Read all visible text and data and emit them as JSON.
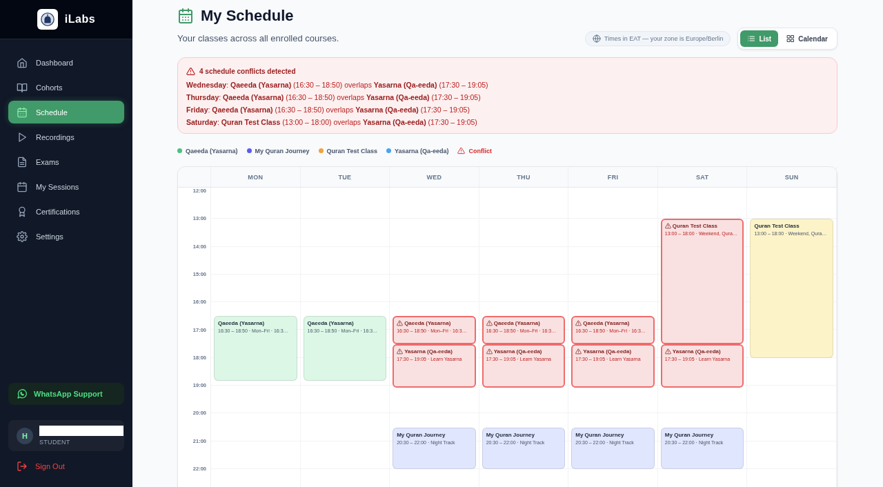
{
  "sidebar": {
    "brand": "iLabs",
    "nav": [
      {
        "label": "Dashboard",
        "selected": false
      },
      {
        "label": "Cohorts",
        "selected": false
      },
      {
        "label": "Schedule",
        "selected": true
      },
      {
        "label": "Recordings",
        "selected": false
      },
      {
        "label": "Exams",
        "selected": false
      },
      {
        "label": "My Sessions",
        "selected": false
      },
      {
        "label": "Certifications",
        "selected": false
      },
      {
        "label": "Settings",
        "selected": false
      }
    ],
    "support": "WhatsApp Support",
    "user": {
      "initial": "H",
      "role": "STUDENT"
    },
    "sign_out": "Sign Out"
  },
  "header": {
    "title": "My Schedule",
    "subtitle": "Your classes across all enrolled courses.",
    "timezone": "Times in EAT — your zone is Europe/Berlin",
    "views": [
      {
        "label": "List",
        "selected": true
      },
      {
        "label": "Calendar",
        "selected": false
      }
    ]
  },
  "conflicts": {
    "title": "4 schedule conflicts detected",
    "lines": [
      "**Wednesday**: **Qaeeda (Yasarna)** (16:30 – 18:50) overlaps **Yasarna (Qa-eeda)** (17:30 – 19:05)",
      "**Thursday**: **Qaeeda (Yasarna)** (16:30 – 18:50) overlaps **Yasarna (Qa-eeda)** (17:30 – 19:05)",
      "**Friday**: **Qaeeda (Yasarna)** (16:30 – 18:50) overlaps **Yasarna (Qa-eeda)** (17:30 – 19:05)",
      "**Saturday**: **Quran Test Class** (13:00 – 18:00) overlaps **Yasarna (Qa-eeda)** (17:30 – 19:05)"
    ]
  },
  "legend": [
    {
      "kind": "course",
      "label": "Qaeeda (Yasarna)",
      "color": "#4fbf7f"
    },
    {
      "kind": "course",
      "label": "My Quran Journey",
      "color": "#5b5bf0"
    },
    {
      "kind": "course",
      "label": "Quran Test Class",
      "color": "#f0a23c"
    },
    {
      "kind": "course",
      "label": "Yasarna (Qa-eeda)",
      "color": "#4aa3ef"
    },
    {
      "kind": "conflict",
      "label": "Conflict"
    }
  ],
  "calendar": {
    "hours": [
      "12:00",
      "13:00",
      "14:00",
      "15:00",
      "16:00",
      "17:00",
      "18:00",
      "19:00",
      "20:00",
      "21:00",
      "22:00"
    ],
    "days": [
      {
        "label": "MON",
        "events": [
          {
            "title": "Qaeeda (Yasarna)",
            "subtitle": "16:30 – 18:50 · Mon–Fri · 16:3…",
            "conflict": false,
            "color": "#dcf7e6"
          }
        ]
      },
      {
        "label": "TUE",
        "events": [
          {
            "title": "Qaeeda (Yasarna)",
            "subtitle": "16:30 – 18:50 · Mon–Fri · 16:3…",
            "conflict": false,
            "color": "#dcf7e6"
          }
        ]
      },
      {
        "label": "WED",
        "events": [
          {
            "title": "Qaeeda (Yasarna)",
            "subtitle": "16:30 – 18:50 · Mon–Fri · 16:3…",
            "conflict": true
          },
          {
            "title": "Yasarna (Qa-eeda)",
            "subtitle": "17:30 – 19:05 · Learn Yasarna",
            "conflict": true
          },
          {
            "title": "My Quran Journey",
            "subtitle": "20:30 – 22:00 · Night Track",
            "conflict": false,
            "color": "#e0e6fd"
          }
        ]
      },
      {
        "label": "THU",
        "events": [
          {
            "title": "Qaeeda (Yasarna)",
            "subtitle": "16:30 – 18:50 · Mon–Fri · 16:3…",
            "conflict": true
          },
          {
            "title": "Yasarna (Qa-eeda)",
            "subtitle": "17:30 – 19:05 · Learn Yasarna",
            "conflict": true
          },
          {
            "title": "My Quran Journey",
            "subtitle": "20:30 – 22:00 · Night Track",
            "conflict": false,
            "color": "#e0e6fd"
          }
        ]
      },
      {
        "label": "FRI",
        "events": [
          {
            "title": "Qaeeda (Yasarna)",
            "subtitle": "16:30 – 18:50 · Mon–Fri · 16:3…",
            "conflict": true
          },
          {
            "title": "Yasarna (Qa-eeda)",
            "subtitle": "17:30 – 19:05 · Learn Yasarna",
            "conflict": true
          },
          {
            "title": "My Quran Journey",
            "subtitle": "20:30 – 22:00 · Night Track",
            "conflict": false,
            "color": "#e0e6fd"
          }
        ]
      },
      {
        "label": "SAT",
        "events": [
          {
            "title": "Quran Test Class",
            "subtitle": "13:00 – 18:00 · Weekend, Qura…",
            "conflict": true
          },
          {
            "title": "Yasarna (Qa-eeda)",
            "subtitle": "17:30 – 19:05 · Learn Yasarna",
            "conflict": true
          },
          {
            "title": "My Quran Journey",
            "subtitle": "20:30 – 22:00 · Night Track",
            "conflict": false,
            "color": "#e0e6fd"
          }
        ]
      },
      {
        "label": "SUN",
        "events": [
          {
            "title": "Quran Test Class",
            "subtitle": "13:00 – 18:00 · Weekend, Qura…",
            "conflict": false,
            "color": "#fdf3c8"
          }
        ]
      }
    ]
  }
}
